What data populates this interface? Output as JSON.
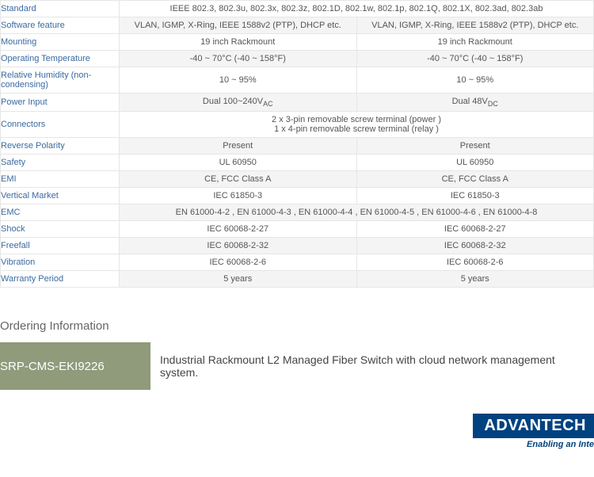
{
  "spec_rows": [
    {
      "label": "Standard",
      "span": true,
      "shade": false,
      "valA": "IEEE 802.3, 802.3u, 802.3x, 802.3z, 802.1D, 802.1w, 802.1p, 802.1Q, 802.1X, 802.3ad, 802.3ab"
    },
    {
      "label": "Software feature",
      "span": false,
      "shade": true,
      "valA": "VLAN, IGMP, X-Ring, IEEE 1588v2 (PTP), DHCP etc.",
      "valB": "VLAN, IGMP, X-Ring, IEEE 1588v2 (PTP), DHCP etc."
    },
    {
      "label": "Mounting",
      "span": false,
      "shade": false,
      "valA": "19 inch Rackmount",
      "valB": "19 inch Rackmount"
    },
    {
      "label": "Operating Temperature",
      "span": false,
      "shade": true,
      "valA": "-40 ~ 70°C (-40 ~ 158°F)",
      "valB": "-40 ~ 70°C (-40 ~ 158°F)"
    },
    {
      "label": "Relative Humidity (non-condensing)",
      "span": false,
      "shade": false,
      "valA": "10 ~ 95%",
      "valB": "10 ~ 95%"
    },
    {
      "label": "Power Input",
      "span": false,
      "shade": true,
      "html": true,
      "valA": "Dual 100~240V<span class='sub'>AC</span>",
      "valB": "Dual 48V<span class='sub'>DC</span>"
    },
    {
      "label": "Connectors",
      "span": true,
      "shade": false,
      "html": true,
      "valA": "2 x 3-pin removable screw terminal (power )<br>1 x 4-pin removable screw terminal (relay )"
    },
    {
      "label": "Reverse Polarity",
      "span": false,
      "shade": true,
      "valA": "Present",
      "valB": "Present"
    },
    {
      "label": "Safety",
      "span": false,
      "shade": false,
      "valA": "UL 60950",
      "valB": "UL 60950"
    },
    {
      "label": "EMI",
      "span": false,
      "shade": true,
      "valA": "CE, FCC Class A",
      "valB": "CE, FCC Class A"
    },
    {
      "label": "Vertical Market",
      "span": false,
      "shade": false,
      "valA": "IEC 61850-3",
      "valB": "IEC 61850-3"
    },
    {
      "label": "EMC",
      "span": true,
      "shade": true,
      "valA": "EN 61000-4-2 , EN 61000-4-3 , EN 61000-4-4 , EN 61000-4-5 , EN 61000-4-6 , EN 61000-4-8"
    },
    {
      "label": "Shock",
      "span": false,
      "shade": false,
      "valA": "IEC 60068-2-27",
      "valB": "IEC 60068-2-27"
    },
    {
      "label": "Freefall",
      "span": false,
      "shade": true,
      "valA": "IEC 60068-2-32",
      "valB": "IEC 60068-2-32"
    },
    {
      "label": "Vibration",
      "span": false,
      "shade": false,
      "valA": "IEC 60068-2-6",
      "valB": "IEC 60068-2-6"
    },
    {
      "label": "Warranty Period",
      "span": false,
      "shade": true,
      "valA": "5 years",
      "valB": "5 years"
    }
  ],
  "ordering": {
    "heading": "Ordering Information",
    "sku": "SRP-CMS-EKI9226",
    "desc": "Industrial Rackmount L2 Managed Fiber Switch with cloud network management system."
  },
  "brand": {
    "name": "ADVANTECH",
    "tagline": "Enabling an Inte"
  }
}
